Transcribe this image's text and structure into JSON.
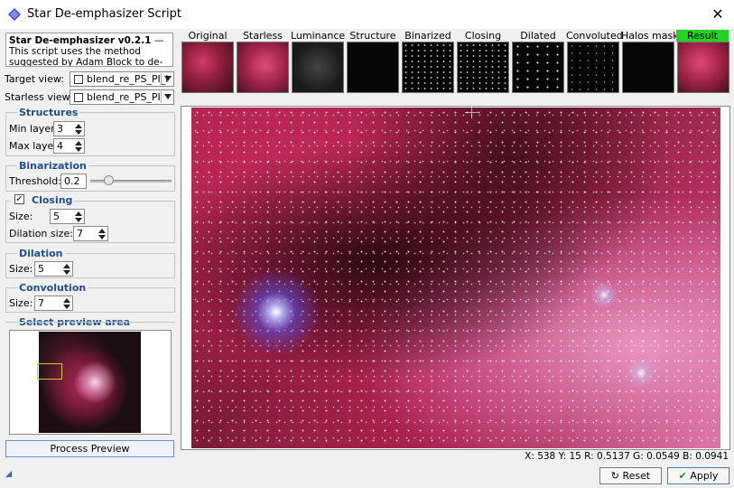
{
  "window": {
    "title": "Star De-emphasizer Script"
  },
  "description": {
    "name": "Star De-emphasizer v0.2.1",
    "text": " — This script uses the method suggested by Adam Block to de-emphasize stars."
  },
  "views": {
    "target_label": "Target view:",
    "target_value": "blend_re_PS_PI_l",
    "starless_label": "Starless view:",
    "starless_value": "blend_re_PS_PI"
  },
  "structures": {
    "title": "Structures",
    "min_label": "Min layer:",
    "min_value": "3",
    "max_label": "Max layer:",
    "max_value": "4"
  },
  "binarization": {
    "title": "Binarization",
    "threshold_label": "Threshold:",
    "threshold_value": "0.2",
    "threshold_level": 0.2
  },
  "closing": {
    "title": "Closing",
    "checked": true,
    "size_label": "Size:",
    "size_value": "5",
    "dilation_label": "Dilation size:",
    "dilation_value": "7"
  },
  "dilation": {
    "title": "Dilation",
    "size_label": "Size:",
    "size_value": "5"
  },
  "convolution": {
    "title": "Convolution",
    "size_label": "Size:",
    "size_value": "7"
  },
  "preview": {
    "title": "Select preview area",
    "process_button": "Process Preview"
  },
  "thumbnails": [
    {
      "label": "Original"
    },
    {
      "label": "Starless"
    },
    {
      "label": "Luminance"
    },
    {
      "label": "Structure"
    },
    {
      "label": "Binarized"
    },
    {
      "label": "Closing"
    },
    {
      "label": "Dilated"
    },
    {
      "label": "Convoluted"
    },
    {
      "label": "Halos mask"
    },
    {
      "label": "Result"
    }
  ],
  "status": {
    "readout": "X: 538 Y: 15 R: 0.5137 G: 0.0549 B: 0.0941"
  },
  "buttons": {
    "reset": "Reset",
    "apply": "Apply"
  },
  "icons": {
    "app": "app-icon",
    "close": "close-icon",
    "reset": "reset-icon",
    "apply": "check-icon"
  },
  "colors": {
    "accent": "#1d4f8c",
    "selected_tab": "#21d421"
  }
}
